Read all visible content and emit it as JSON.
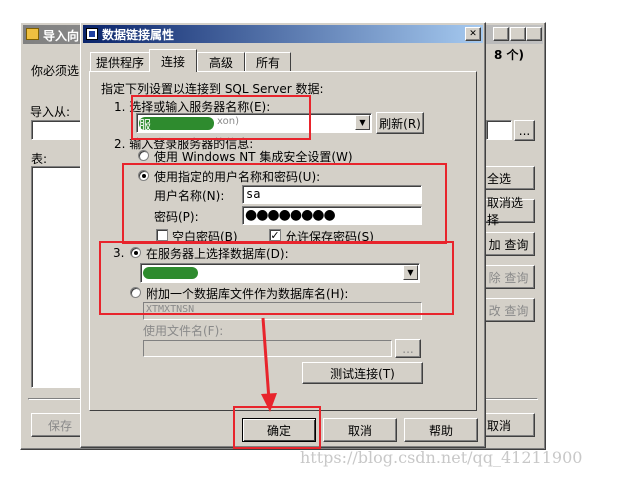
{
  "colors": {
    "annotation_red": "#e8242c",
    "title_active": "#0a246a",
    "face": "#d4d0c8",
    "green_blur": "#2e8b2e"
  },
  "bg_window": {
    "title": "导入向",
    "count_text": "8 个)",
    "instruction": "你必须选",
    "import_from_label": "导入从:",
    "browse_button": "...",
    "table_label": "表:",
    "buttons": {
      "select_all": "全选",
      "cancel_select": "取消选择",
      "query1": "加 查询",
      "query2": "除 查询",
      "query3": "改 查询"
    },
    "save_button": "保存",
    "cancel_button": "取消"
  },
  "dialog": {
    "title": "数据链接属性",
    "close_glyph": "✕",
    "tabs": [
      "提供程序",
      "连接",
      "高级",
      "所有"
    ],
    "intro": "指定下列设置以连接到 SQL Server 数据:",
    "step1": "1. 选择或输入服务器名称(E):",
    "server_partial": "服",
    "server_partial2": "xon)",
    "refresh_button": "刷新(R)",
    "step2": "2. 输入登录服务器的信息:",
    "opt_windows_nt": "使用 Windows NT 集成安全设置(W)",
    "opt_specific_user": "使用指定的用户名称和密码(U):",
    "username_label": "用户名称(N):",
    "username_value": "sa",
    "password_label": "密码(P):",
    "password_value": "●●●●●●●●",
    "blank_password": "空白密码(B)",
    "allow_save_password": "允许保存密码(S)",
    "allow_save_check": "✓",
    "step3_prefix": "3.",
    "opt_select_db": "在服务器上选择数据库(D):",
    "opt_attach_db": "附加一个数据库文件作为数据库名(H):",
    "attach_db_value": "XTMXTNSN",
    "use_filename_label": "使用文件名(F):",
    "browse_file_button": "...",
    "test_connection_button": "测试连接(T)",
    "ok_button": "确定",
    "cancel_button": "取消",
    "help_button": "帮助"
  },
  "watermark": "https://blog.csdn.net/qq_41211900"
}
